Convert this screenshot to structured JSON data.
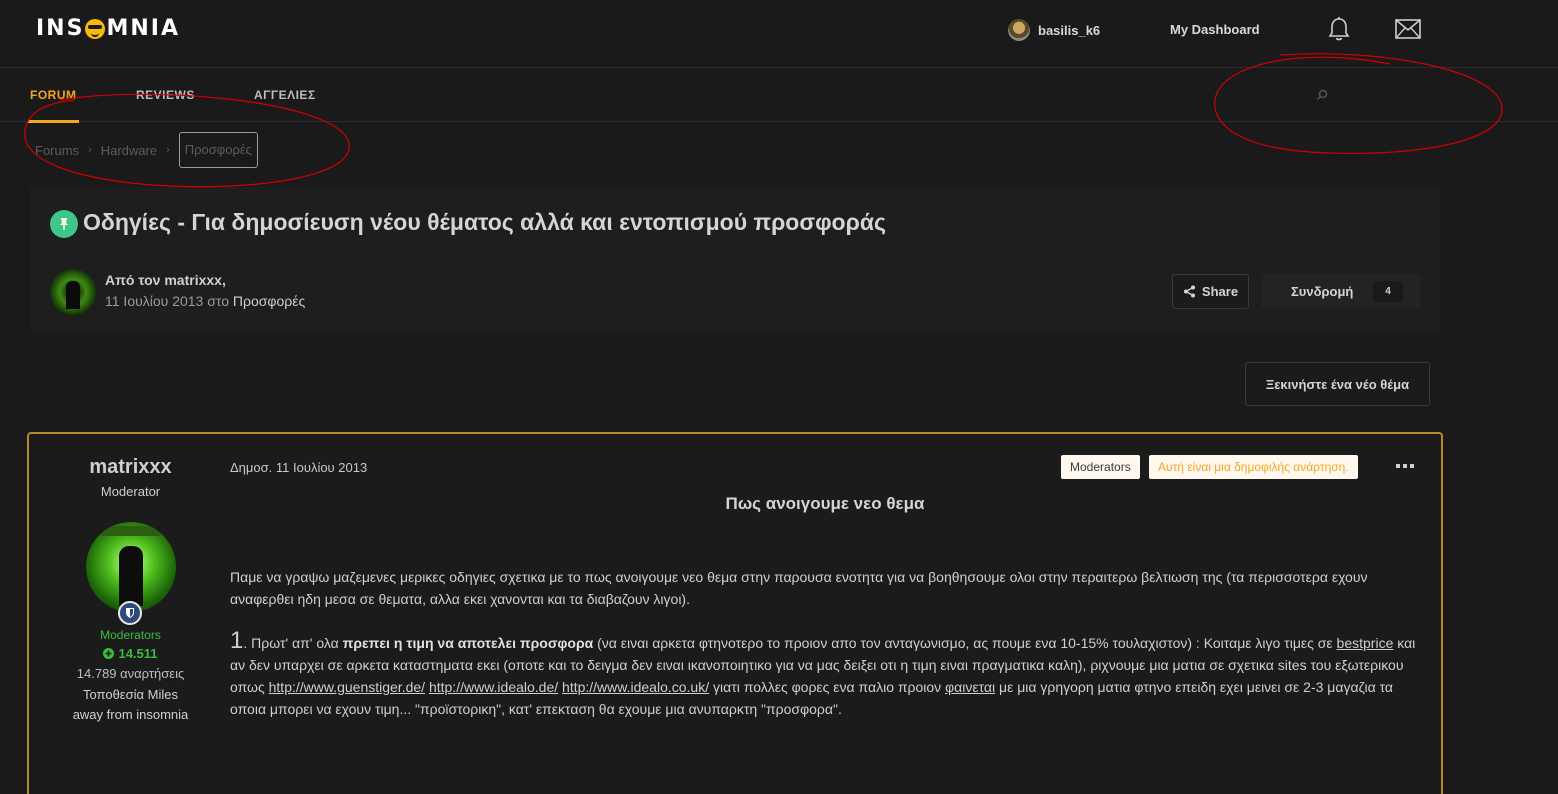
{
  "header": {
    "logo_left": "INS",
    "logo_right": "MNIA",
    "username": "basilis_k6",
    "dashboard_label": "My Dashboard"
  },
  "nav": {
    "tabs": [
      {
        "label": "FORUM",
        "active": true
      },
      {
        "label": "REVIEWS",
        "active": false
      },
      {
        "label": "ΑΓΓΕΛΙΕΣ",
        "active": false
      }
    ]
  },
  "breadcrumb": {
    "items": [
      "Forums",
      "Hardware",
      "Προσφορές"
    ]
  },
  "topic": {
    "title": "Οδηγίες - Για δημοσίευση νέου θέματος αλλά και εντοπισμού προσφοράς",
    "by_line": "Από τον matrixxx,",
    "date": "11 Ιουλίου 2013 στο ",
    "forum": "Προσφορές",
    "share_label": "Share",
    "follow_label": "Συνδρομή",
    "follow_count": "4"
  },
  "start_topic_label": "Ξεκινήστε ένα νέο θέμα",
  "post": {
    "author": "matrixxx",
    "role": "Moderator",
    "group": "Moderators",
    "reputation": "14.511",
    "post_count": "14.789 αναρτήσεις",
    "location": "Τοποθεσία Miles away from insomnia",
    "date": "Δημοσ. 11 Ιουλίου 2013",
    "tag_moderators": "Moderators",
    "tag_popular": "Αυτή είναι μια δημοφιλής ανάρτηση.",
    "heading": "Πως ανοιγουμε νεο θεμα",
    "para1": "Παμε να γραψω μαζεμενες μερικες οδηγιες σχετικα με το πως ανοιγουμε νεο θεμα στην παρουσα ενοτητα για να βοηθησουμε ολοι στην περαιτερω βελτιωση της (τα περισσοτερα εχουν αναφερθει ηδη μεσα σε θεματα, αλλα εκει χανονται και τα διαβαζουν λιγοι).",
    "para2": {
      "num": "1",
      "t1": ". Πρωτ' απ' ολα ",
      "bold": "πρεπει η τιμη να αποτελει προσφορα",
      "t2": " (να ειναι αρκετα φτηνοτερο το προιον απο τον ανταγωνισμο, ας πουμε ενα 10-15% τουλαχιστον) : Κοιταμε λιγο τιμες σε ",
      "link1": "bestprice",
      "t3": " και αν δεν υπαρχει σε αρκετα καταστηματα εκει (οποτε και το δειγμα δεν ειναι ικανοποιητικο για να μας δειξει οτι η τιμη ειναι πραγματικα καλη), ριχνουμε μια ματια σε σχετικα sites του εξωτερικου οπως ",
      "link2": "http://www.guenstiger.de/",
      "t4": "  ",
      "link3": "http://www.idealo.de/",
      "t5": " ",
      "link4": "http://www.idealo.co.uk/",
      "t6": " γιατι πολλες φορες ενα παλιο προιον ",
      "link5": "φαινεται",
      "t7": " με μια γρηγορη ματια φτηνο επειδη εχει μεινει σε 2-3 μαγαζια τα οποια μπορει να εχουν τιμη... \"προϊστορικη\", κατ' επεκταση θα εχουμε μια ανυπαρκτη \"προσφορα\"."
    }
  },
  "colors": {
    "accent": "#f5a623",
    "post_border": "#b38a2a",
    "moderator_green": "#3bbd3b",
    "pin_green": "#3ec78a",
    "annotation_red": "#d10000"
  }
}
